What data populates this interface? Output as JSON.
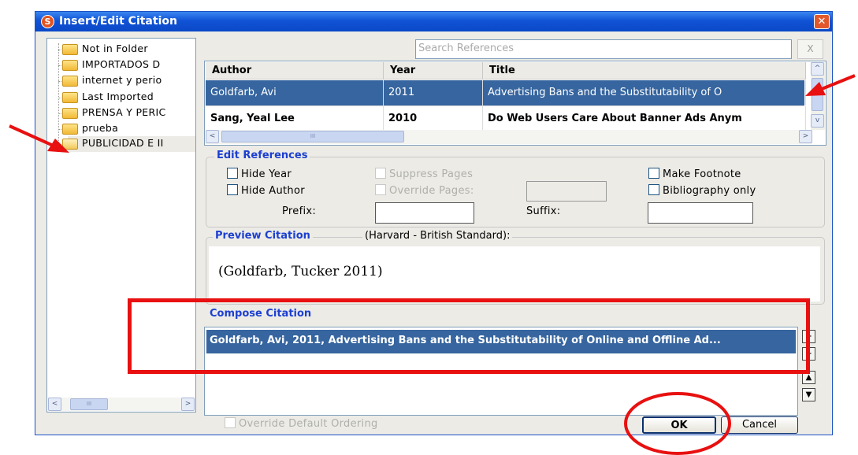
{
  "window": {
    "title": "Insert/Edit Citation",
    "close_glyph": "✕",
    "icon_glyph": "S"
  },
  "folders": [
    {
      "label": "Not in Folder"
    },
    {
      "label": "IMPORTADOS D"
    },
    {
      "label": "internet y perio"
    },
    {
      "label": "Last Imported"
    },
    {
      "label": "PRENSA Y PERIC"
    },
    {
      "label": "prueba"
    },
    {
      "label": "PUBLICIDAD E II",
      "selected": true
    }
  ],
  "search": {
    "placeholder": "Search References",
    "clear_label": "X"
  },
  "references": {
    "columns": [
      "Author",
      "Year",
      "Title"
    ],
    "rows": [
      {
        "author": "Goldfarb, Avi",
        "year": "2011",
        "title": "Advertising Bans and the Substitutability of O",
        "selected": true
      },
      {
        "author": "Sang, Yeal Lee",
        "year": "2010",
        "title": "Do Web Users Care About Banner Ads Anym"
      }
    ]
  },
  "edit_references": {
    "legend": "Edit References",
    "hide_year": "Hide Year",
    "hide_author": "Hide Author",
    "suppress_pages": "Suppress Pages",
    "override_pages": "Override Pages:",
    "make_footnote": "Make Footnote",
    "bibliography_only": "Bibliography only",
    "prefix_label": "Prefix:",
    "suffix_label": "Suffix:",
    "prefix_value": "",
    "suffix_value": ""
  },
  "preview": {
    "legend": "Preview Citation",
    "style": "(Harvard - British Standard):",
    "text": "(Goldfarb, Tucker 2011)"
  },
  "compose": {
    "legend": "Compose Citation",
    "item": "Goldfarb, Avi, 2011, Advertising Bans and the Substitutability of Online and Offline Ad..."
  },
  "footer": {
    "override_ordering": "Override Default Ordering",
    "ok_label": "OK",
    "cancel_label": "Cancel"
  },
  "colors": {
    "selection": "#36659f",
    "legend": "#1c3fd1",
    "annotation_red": "#e81010",
    "titlebar": "#0a48c6"
  },
  "scroll": {
    "left": "<",
    "right": ">",
    "up": "^",
    "down": "v",
    "grip": "III"
  }
}
